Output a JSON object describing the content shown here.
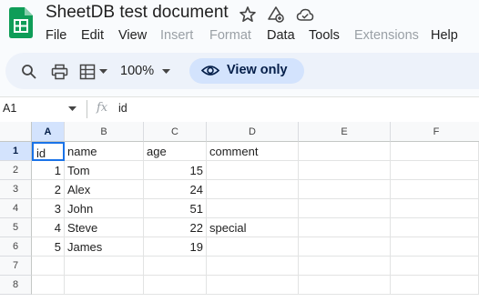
{
  "header": {
    "title": "SheetDB test document",
    "menus": [
      {
        "label": "File",
        "disabled": false
      },
      {
        "label": "Edit",
        "disabled": false
      },
      {
        "label": "View",
        "disabled": false
      },
      {
        "label": "Insert",
        "disabled": true
      },
      {
        "label": "Format",
        "disabled": true
      },
      {
        "label": "Data",
        "disabled": false
      },
      {
        "label": "Tools",
        "disabled": false
      },
      {
        "label": "Extensions",
        "disabled": true
      },
      {
        "label": "Help",
        "disabled": false
      }
    ]
  },
  "toolbar": {
    "zoom": "100%",
    "view_only_label": "View only"
  },
  "formula_bar": {
    "name_box": "A1",
    "fx": "fx",
    "value": "id"
  },
  "grid": {
    "columns": [
      "A",
      "B",
      "C",
      "D",
      "E",
      "F"
    ],
    "rows": [
      "1",
      "2",
      "3",
      "4",
      "5",
      "6",
      "7",
      "8"
    ],
    "cells": [
      [
        "id",
        "name",
        "age",
        "comment",
        "",
        ""
      ],
      [
        "1",
        "Tom",
        "15",
        "",
        "",
        ""
      ],
      [
        "2",
        "Alex",
        "24",
        "",
        "",
        ""
      ],
      [
        "3",
        "John",
        "51",
        "",
        "",
        ""
      ],
      [
        "4",
        "Steve",
        "22",
        "special",
        "",
        ""
      ],
      [
        "5",
        "James",
        "19",
        "",
        "",
        ""
      ],
      [
        "",
        "",
        "",
        "",
        "",
        ""
      ],
      [
        "",
        "",
        "",
        "",
        "",
        ""
      ]
    ],
    "active_cell": "A1"
  },
  "colors": {
    "accent": "#1a73e8",
    "sheets_green": "#0f9d58",
    "view_only_bg": "#d3e3fd"
  }
}
